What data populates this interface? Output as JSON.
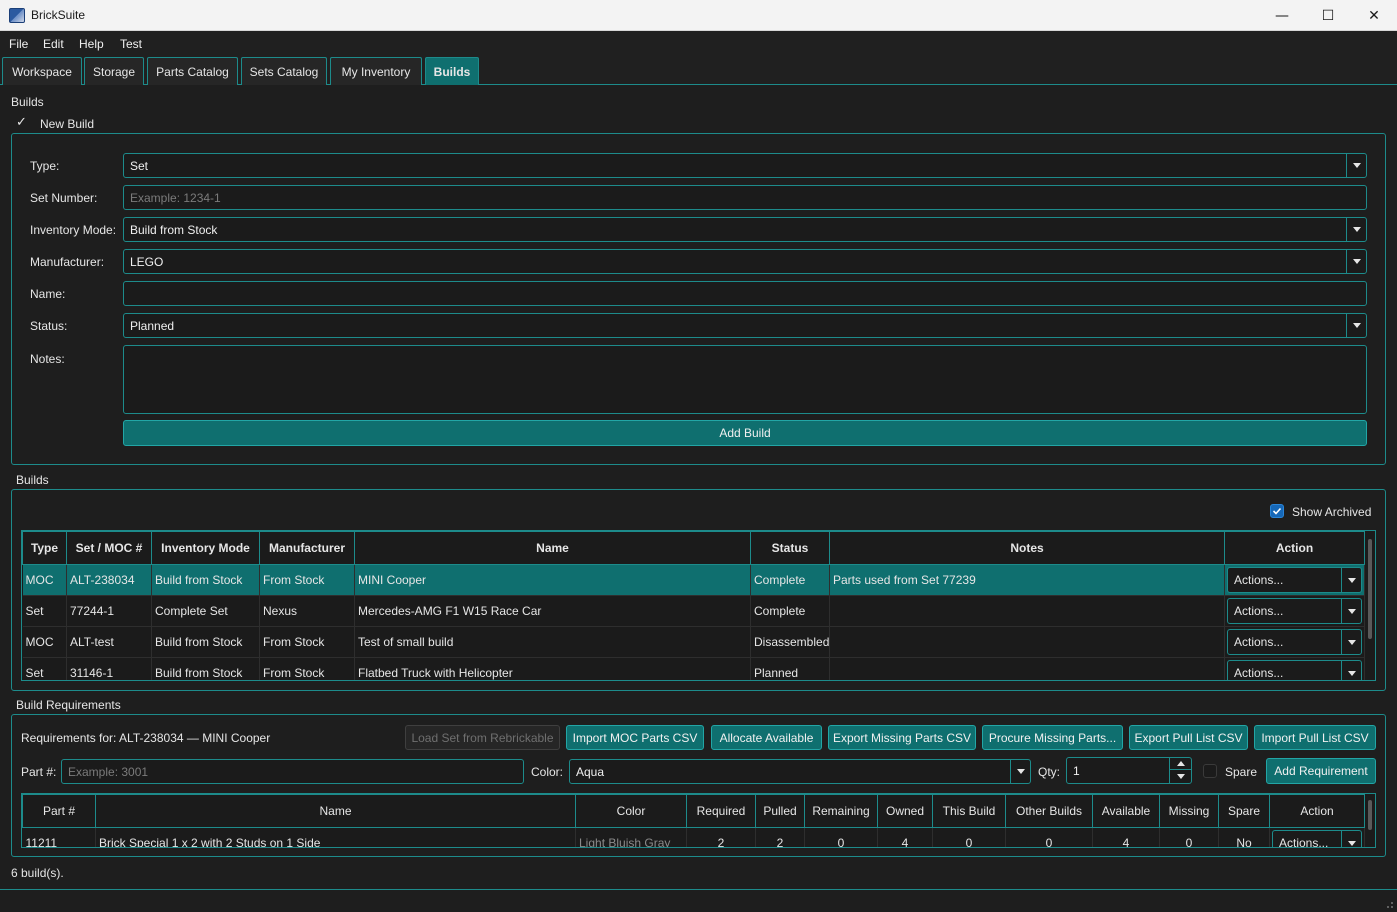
{
  "window": {
    "title": "BrickSuite",
    "minimize_glyph": "—",
    "maximize_glyph": "☐",
    "close_glyph": "✕"
  },
  "menu": [
    "File",
    "Edit",
    "Help",
    "Test"
  ],
  "tabs": [
    "Workspace",
    "Storage",
    "Parts Catalog",
    "Sets Catalog",
    "My Inventory",
    "Builds"
  ],
  "active_tab": "Builds",
  "page": {
    "section_title": "Builds",
    "new_build_toggle": "New Build",
    "new_build_checkmark": "✓"
  },
  "form": {
    "type_label": "Type:",
    "type_value": "Set",
    "set_number_label": "Set Number:",
    "set_number_placeholder": "Example: 1234-1",
    "inventory_mode_label": "Inventory Mode:",
    "inventory_mode_value": "Build from Stock",
    "manufacturer_label": "Manufacturer:",
    "manufacturer_value": "LEGO",
    "name_label": "Name:",
    "name_value": "",
    "status_label": "Status:",
    "status_value": "Planned",
    "notes_label": "Notes:",
    "notes_value": "",
    "add_build_button": "Add Build"
  },
  "builds": {
    "group_title": "Builds",
    "show_archived_label": "Show Archived",
    "show_archived_checked": true,
    "columns": [
      "Type",
      "Set / MOC #",
      "Inventory Mode",
      "Manufacturer",
      "Name",
      "Status",
      "Notes",
      "Action"
    ],
    "rows": [
      {
        "type": "MOC",
        "number": "ALT-238034",
        "mode": "Build from Stock",
        "manufacturer": "From Stock",
        "name": "MINI Cooper",
        "status": "Complete",
        "notes": "Parts used from Set 77239",
        "action": "Actions...",
        "selected": true
      },
      {
        "type": "Set",
        "number": "77244-1",
        "mode": "Complete Set",
        "manufacturer": "Nexus",
        "name": "Mercedes-AMG F1 W15 Race Car",
        "status": "Complete",
        "notes": "",
        "action": "Actions..."
      },
      {
        "type": "MOC",
        "number": "ALT-test",
        "mode": "Build from Stock",
        "manufacturer": "From Stock",
        "name": "Test of small build",
        "status": "Disassembled",
        "notes": "",
        "action": "Actions..."
      },
      {
        "type": "Set",
        "number": "31146-1",
        "mode": "Build from Stock",
        "manufacturer": "From Stock",
        "name": "Flatbed Truck with Helicopter",
        "status": "Planned",
        "notes": "",
        "action": "Actions..."
      }
    ]
  },
  "requirements": {
    "group_title": "Build Requirements",
    "requirements_for": "Requirements for: ALT-238034 — MINI Cooper",
    "buttons": {
      "load_set": "Load Set from Rebrickable",
      "import_moc": "Import MOC Parts CSV",
      "allocate": "Allocate Available",
      "export_missing": "Export Missing Parts CSV",
      "procure_missing": "Procure Missing Parts...",
      "export_pull": "Export Pull List CSV",
      "import_pull": "Import Pull List CSV",
      "add_requirement": "Add Requirement"
    },
    "part_label": "Part #:",
    "part_placeholder": "Example: 3001",
    "color_label": "Color:",
    "color_value": "Aqua",
    "qty_label": "Qty:",
    "qty_value": "1",
    "spare_label": "Spare",
    "columns": [
      "Part #",
      "Name",
      "Color",
      "Required",
      "Pulled",
      "Remaining",
      "Owned",
      "This Build",
      "Other Builds",
      "Available",
      "Missing",
      "Spare",
      "Action"
    ],
    "rows": [
      {
        "part": "11211",
        "name": "Brick Special 1 x 2 with 2 Studs on 1 Side",
        "color": "Light Bluish Gray",
        "required": "2",
        "pulled": "2",
        "remaining": "0",
        "owned": "4",
        "this_build": "0",
        "other_builds": "0",
        "available": "4",
        "missing": "0",
        "spare": "No",
        "action": "Actions..."
      }
    ]
  },
  "status_text": "6 build(s).",
  "colors": {
    "accent": "#1d8b8b",
    "selected": "#0f6f6f",
    "background": "#1e1e1e"
  }
}
